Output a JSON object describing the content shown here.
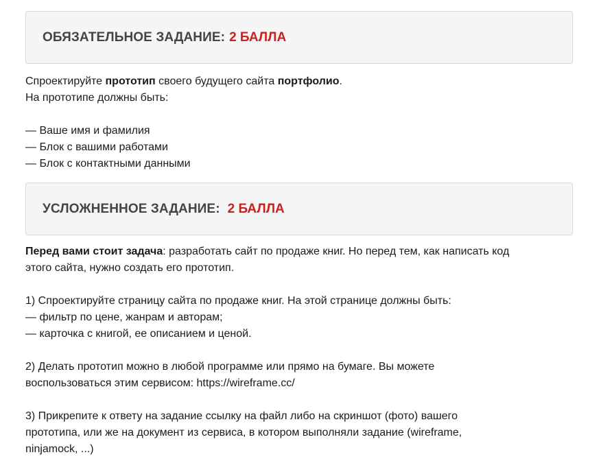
{
  "required_task": {
    "title": "ОБЯЗАТЕЛЬНОЕ ЗАДАНИЕ:",
    "points": "2 БАЛЛА"
  },
  "required_text": {
    "line1_part1": "Спроектируйте ",
    "line1_bold1": "прототип",
    "line1_part2": " своего будущего сайта ",
    "line1_bold2": "портфолио",
    "line1_part3": ".",
    "line2": "На прототипе должны быть:",
    "items": [
      "— Ваше имя и фамилия",
      "— Блок с вашими работами",
      "— Блок с контактными данными"
    ]
  },
  "advanced_task": {
    "title": "УСЛОЖНЕННОЕ ЗАДАНИЕ:",
    "points": "2 БАЛЛА"
  },
  "advanced_text": {
    "intro_bold": "Перед вами стоит задача",
    "intro_line1": ": разработать сайт по продаже книг. Но перед тем, как написать код",
    "intro_line2": "этого сайта, нужно создать его прототип.",
    "step1_line1": "1) Спроектируйте страницу сайта по продаже книг. На этой странице должны быть:",
    "step1_line2": "— фильтр по цене, жанрам и авторам;",
    "step1_line3": "— карточка с книгой, ее описанием и ценой.",
    "step2_line1": "2) Делать прототип можно в любой программе или прямо на бумаге. Вы можете",
    "step2_line2_prefix": "воспользоваться этим сервисом: ",
    "step2_link": "https://wireframe.cc/",
    "step3_line1": "3) Прикрепите к ответу на задание ссылку на файл либо на скриншот (фото) вашего",
    "step3_line2": "прототипа, или же на документ из сервиса, в котором выполняли задание (wireframe,",
    "step3_line3": "ninjamock, ...)"
  },
  "colors": {
    "accent_red": "#cc1f1f",
    "box_bg": "#f5f5f5",
    "heading_gray": "#444444"
  }
}
